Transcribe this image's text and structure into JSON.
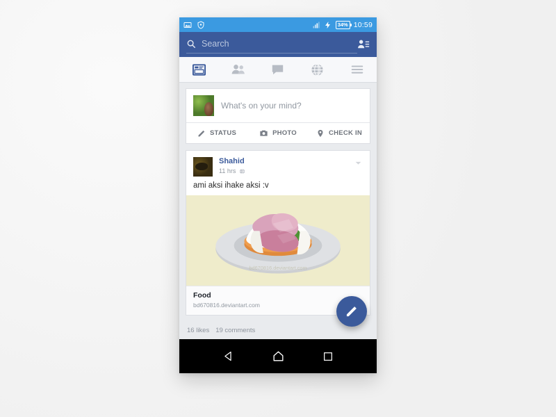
{
  "device": {
    "statusbar": {
      "icons": [
        "screenshot-icon",
        "shield-icon",
        "signal-icon",
        "charging-icon"
      ],
      "battery": "34%",
      "time": "10:59"
    },
    "navbar": {
      "back_label": "back-icon",
      "home_label": "home-icon",
      "recents_label": "recents-icon"
    }
  },
  "header": {
    "search_placeholder": "Search",
    "search_icon": "search-icon",
    "contacts_icon": "friend-requests-icon",
    "brand_color": "#3b5a9b",
    "statusbar_color": "#3b9ae1"
  },
  "tabs": [
    {
      "name": "news-feed",
      "icon": "news-feed-icon",
      "active": true
    },
    {
      "name": "friends",
      "icon": "friends-icon",
      "active": false
    },
    {
      "name": "messages",
      "icon": "messenger-icon",
      "active": false
    },
    {
      "name": "notifications",
      "icon": "globe-icon",
      "active": false
    },
    {
      "name": "more",
      "icon": "hamburger-menu-icon",
      "active": false
    }
  ],
  "composer": {
    "placeholder": "What's on your mind?",
    "avatar": "user-avatar",
    "actions": [
      {
        "label": "STATUS",
        "icon": "pencil-icon"
      },
      {
        "label": "PHOTO",
        "icon": "camera-icon"
      },
      {
        "label": "CHECK IN",
        "icon": "location-pin-icon"
      }
    ]
  },
  "post": {
    "author": "Shahid",
    "timestamp": "11 hrs",
    "privacy_icon": "globe-icon",
    "menu_icon": "chevron-down-icon",
    "text": "ami aksi ihake aksi :v",
    "media_alt": "food-illustration",
    "link": {
      "title": "Food",
      "url": "bd670816.deviantart.com"
    },
    "likes": "16 likes",
    "comments": "19 comments"
  },
  "fab": {
    "icon": "pencil-icon",
    "color": "#3b5a9b"
  }
}
